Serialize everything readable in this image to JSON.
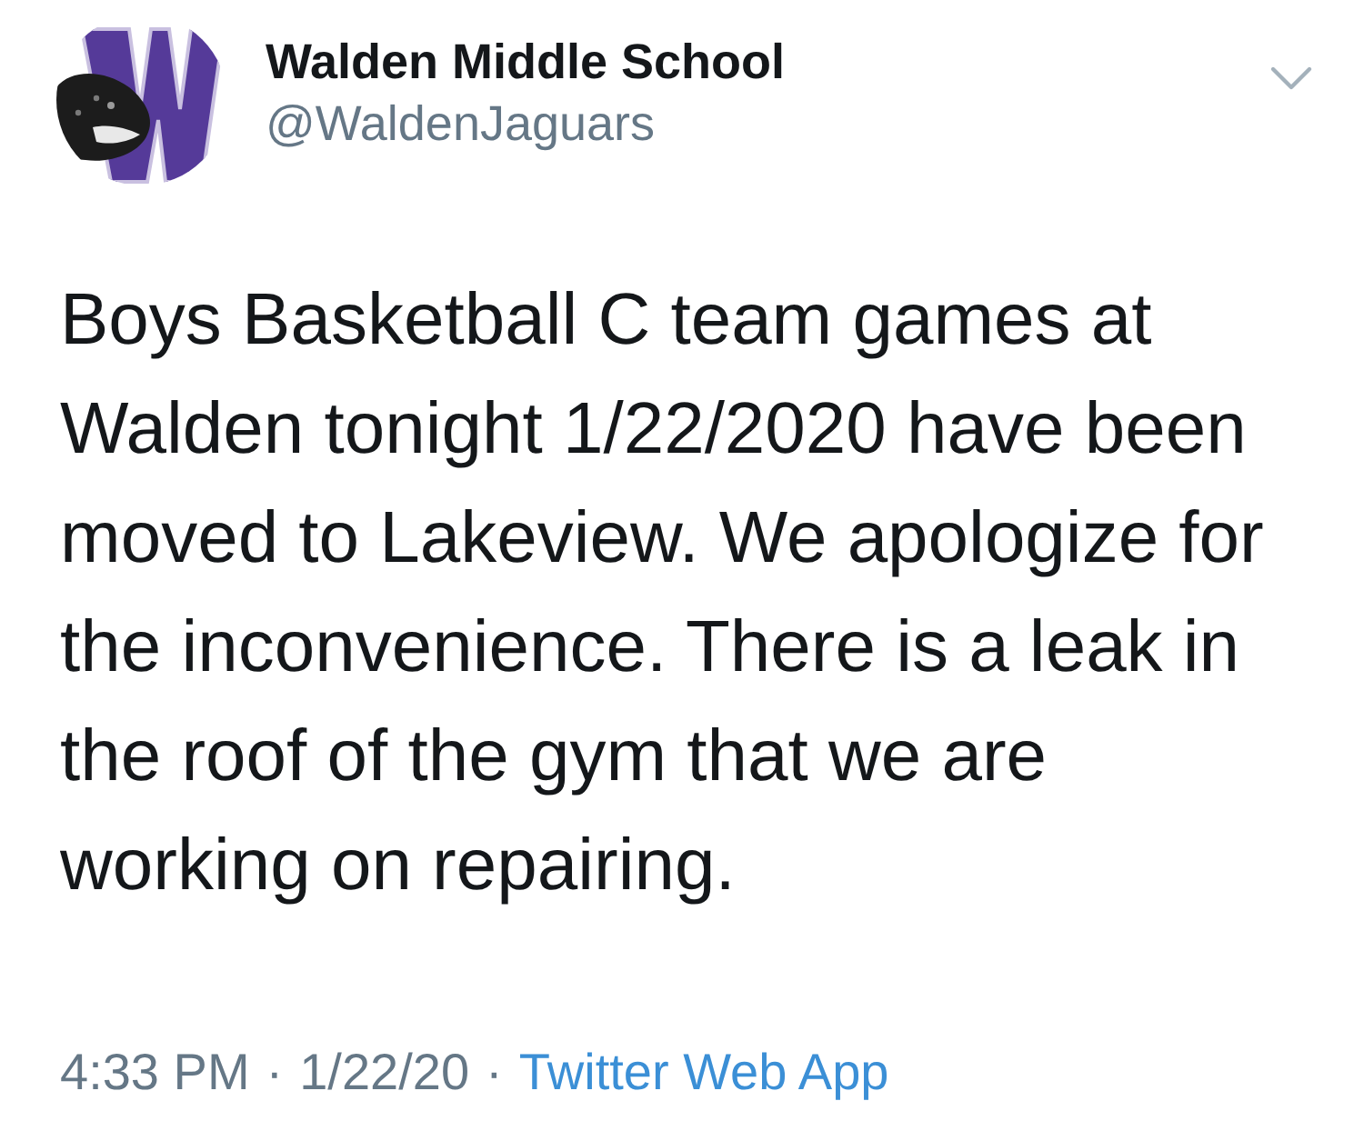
{
  "author": {
    "name": "Walden Middle School",
    "handle": "@WaldenJaguars"
  },
  "tweet": {
    "lines": [
      "Boys Basketball C team games at",
      "Walden tonight 1/22/2020 have been",
      "moved to Lakeview. We apologize for",
      "the inconvenience. There is a leak in",
      "the roof of the gym that we are",
      "working on repairing."
    ]
  },
  "meta": {
    "time": "4:33 PM",
    "separator_1": "·",
    "date": "1/22/20",
    "separator_2": "·",
    "source": "Twitter Web App"
  }
}
